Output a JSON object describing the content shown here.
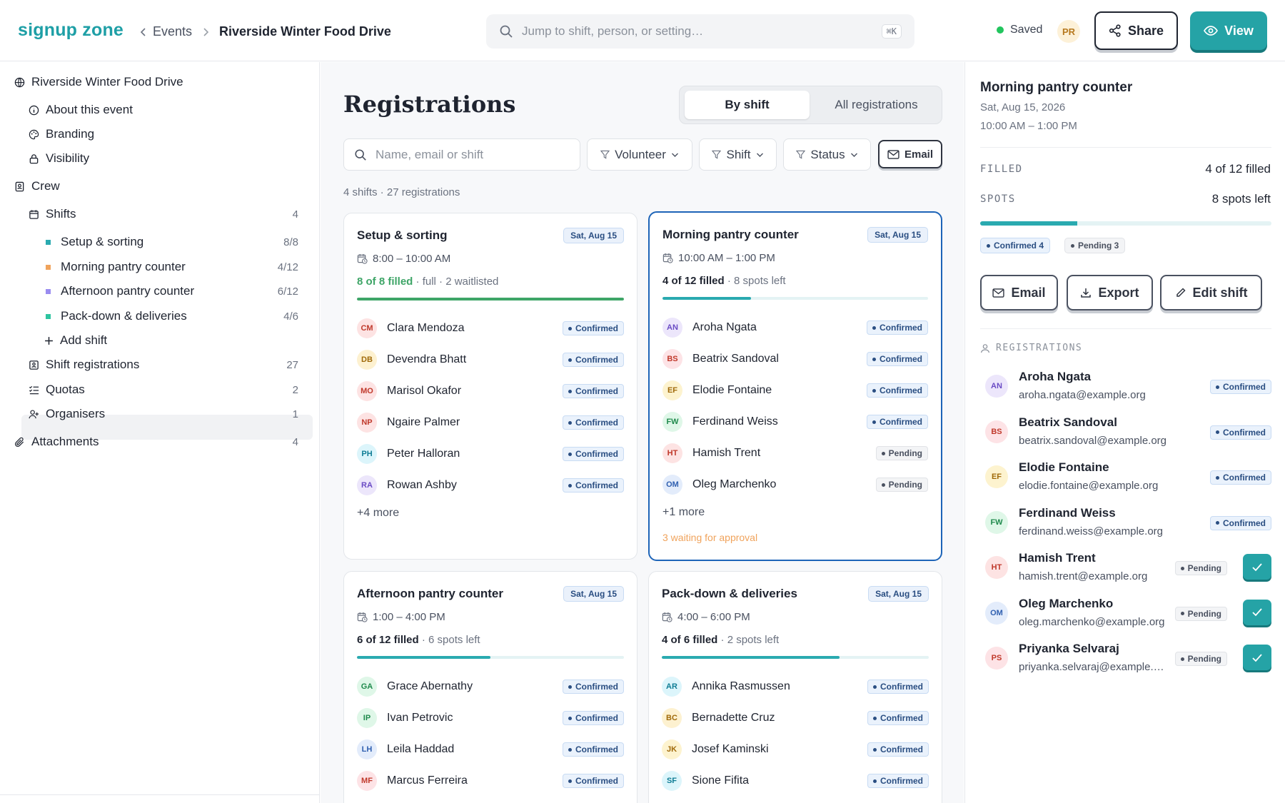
{
  "header": {
    "logo": "signup zone",
    "crumb_events": "Events",
    "crumb_current": "Riverside Winter Food Drive",
    "search_placeholder": "Jump to shift, person, or setting…",
    "search_shortcut": "⌘K",
    "saved_label": "Saved",
    "avatar": "PR",
    "share_label": "Share",
    "view_label": "View"
  },
  "sidebar": {
    "event": "Riverside Winter Food Drive",
    "about": "About this event",
    "branding": "Branding",
    "visibility": "Visibility",
    "crew": "Crew",
    "shifts": {
      "label": "Shifts",
      "count": "4"
    },
    "shift_items": [
      {
        "label": "Setup & sorting",
        "count": "8/8",
        "color": "#2aaab0"
      },
      {
        "label": "Morning pantry counter",
        "count": "4/12",
        "color": "#f0a35c"
      },
      {
        "label": "Afternoon pantry counter",
        "count": "6/12",
        "color": "#9a8cf0"
      },
      {
        "label": "Pack-down & deliveries",
        "count": "4/6",
        "color": "#2ec4a0"
      }
    ],
    "add_shift": "Add shift",
    "shift_registrations": {
      "label": "Shift registrations",
      "count": "27"
    },
    "quotas": {
      "label": "Quotas",
      "count": "2"
    },
    "organisers": {
      "label": "Organisers",
      "count": "1"
    },
    "attachments": {
      "label": "Attachments",
      "count": "4"
    }
  },
  "main": {
    "title": "Registrations",
    "tab_by_shift": "By shift",
    "tab_all": "All registrations",
    "search_placeholder": "Name, email or shift",
    "filter_volunteer": "Volunteer",
    "filter_shift": "Shift",
    "filter_status": "Status",
    "email_label": "Email",
    "summary": "4 shifts · 27 registrations"
  },
  "cards": [
    {
      "title": "Setup & sorting",
      "date": "Sat, Aug 15",
      "time": "8:00 – 10:00 AM",
      "filled": "8 of 8 filled",
      "detail": " · full · 2 waitlisted",
      "progress": 1.0,
      "people": [
        {
          "initials": "CM",
          "name": "Clara Mendoza",
          "status": "Confirmed"
        },
        {
          "initials": "DB",
          "name": "Devendra Bhatt",
          "status": "Confirmed"
        },
        {
          "initials": "MO",
          "name": "Marisol Okafor",
          "status": "Confirmed"
        },
        {
          "initials": "NP",
          "name": "Ngaire Palmer",
          "status": "Confirmed"
        },
        {
          "initials": "PH",
          "name": "Peter Halloran",
          "status": "Confirmed"
        },
        {
          "initials": "RA",
          "name": "Rowan Ashby",
          "status": "Confirmed"
        }
      ],
      "more": "+4 more"
    },
    {
      "title": "Morning pantry counter",
      "date": "Sat, Aug 15",
      "time": "10:00 AM – 1:00 PM",
      "filled": "4 of 12 filled",
      "detail": " · 8 spots left",
      "progress": 0.333,
      "people": [
        {
          "initials": "AN",
          "name": "Aroha Ngata",
          "status": "Confirmed"
        },
        {
          "initials": "BS",
          "name": "Beatrix Sandoval",
          "status": "Confirmed"
        },
        {
          "initials": "EF",
          "name": "Elodie Fontaine",
          "status": "Confirmed"
        },
        {
          "initials": "FW",
          "name": "Ferdinand Weiss",
          "status": "Confirmed"
        },
        {
          "initials": "HT",
          "name": "Hamish Trent",
          "status": "Pending"
        },
        {
          "initials": "OM",
          "name": "Oleg Marchenko",
          "status": "Pending"
        }
      ],
      "more": "+1 more",
      "waiting": "3 waiting for approval"
    },
    {
      "title": "Afternoon pantry counter",
      "date": "Sat, Aug 15",
      "time": "1:00 – 4:00 PM",
      "filled": "6 of 12 filled",
      "detail": " · 6 spots left",
      "progress": 0.5,
      "people": [
        {
          "initials": "GA",
          "name": "Grace Abernathy",
          "status": "Confirmed"
        },
        {
          "initials": "IP",
          "name": "Ivan Petrovic",
          "status": "Confirmed"
        },
        {
          "initials": "LH",
          "name": "Leila Haddad",
          "status": "Confirmed"
        },
        {
          "initials": "MF",
          "name": "Marcus Ferreira",
          "status": "Confirmed"
        }
      ]
    },
    {
      "title": "Pack-down & deliveries",
      "date": "Sat, Aug 15",
      "time": "4:00 – 6:00 PM",
      "filled": "4 of 6 filled",
      "detail": " · 2 spots left",
      "progress": 0.667,
      "people": [
        {
          "initials": "AR",
          "name": "Annika Rasmussen",
          "status": "Confirmed"
        },
        {
          "initials": "BC",
          "name": "Bernadette Cruz",
          "status": "Confirmed"
        },
        {
          "initials": "JK",
          "name": "Josef Kaminski",
          "status": "Confirmed"
        },
        {
          "initials": "SF",
          "name": "Sione Fifita",
          "status": "Confirmed"
        }
      ]
    }
  ],
  "panel": {
    "title": "Morning pantry counter",
    "date": "Sat, Aug 15, 2026",
    "time": "10:00 AM – 1:00 PM",
    "filled_label": "FILLED",
    "filled_value": "4 of 12 filled",
    "spots_label": "SPOTS",
    "spots_value": "8 spots left",
    "progress": 0.333,
    "confirmed_chip": "Confirmed 4",
    "pending_chip": "Pending 3",
    "email_btn": "Email",
    "export_btn": "Export",
    "edit_btn": "Edit shift",
    "registrations_heading": "REGISTRATIONS",
    "registrations": [
      {
        "initials": "AN",
        "name": "Aroha Ngata",
        "email": "aroha.ngata@example.org",
        "status": "Confirmed"
      },
      {
        "initials": "BS",
        "name": "Beatrix Sandoval",
        "email": "beatrix.sandoval@example.org",
        "status": "Confirmed"
      },
      {
        "initials": "EF",
        "name": "Elodie Fontaine",
        "email": "elodie.fontaine@example.org",
        "status": "Confirmed"
      },
      {
        "initials": "FW",
        "name": "Ferdinand Weiss",
        "email": "ferdinand.weiss@example.org",
        "status": "Confirmed"
      },
      {
        "initials": "HT",
        "name": "Hamish Trent",
        "email": "hamish.trent@example.org",
        "status": "Pending"
      },
      {
        "initials": "OM",
        "name": "Oleg Marchenko",
        "email": "oleg.marchenko@example.org",
        "status": "Pending"
      },
      {
        "initials": "PS",
        "name": "Priyanka Selvaraj",
        "email": "priyanka.selvaraj@example.org",
        "status": "Pending"
      }
    ]
  },
  "colors": {
    "accent": "#25a3a6",
    "selected_border": "#1d64b8",
    "full_green": "#3ea567",
    "waiting_orange": "#f0a35c"
  }
}
